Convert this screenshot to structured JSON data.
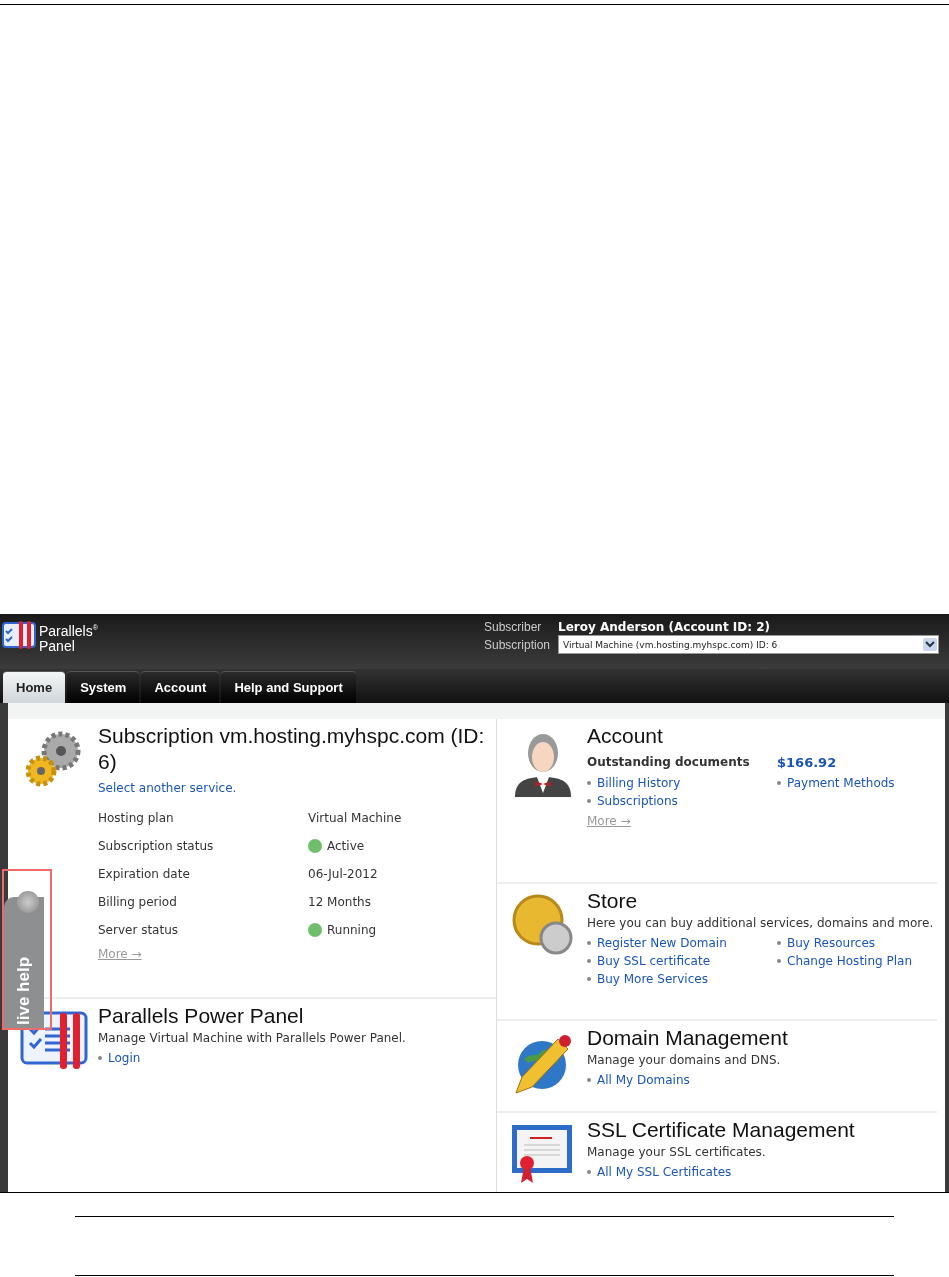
{
  "header": {
    "logo_lines": [
      "Parallels$^{®}$",
      "Panel"
    ],
    "subscriber": {
      "label": "Subscriber",
      "value": "Leroy Anderson (Account ID: 2)"
    },
    "subscription": {
      "label": "Subscription",
      "value": "Virtual Machine (vm.hosting.myhspc.com) ID: 6"
    }
  },
  "tabs": [
    {
      "label": "Home",
      "selected": true
    },
    {
      "label": "System",
      "selected": false
    },
    {
      "label": "Account",
      "selected": false
    },
    {
      "label": "Help and Support",
      "selected": false
    }
  ],
  "live_help": {
    "label": "live help"
  },
  "subscription_section": {
    "title": "Subscription vm.hosting.myhspc.com (ID: 6)",
    "link": "Select another service.",
    "details": [
      {
        "label": "Hosting plan",
        "value": "Virtual Machine"
      },
      {
        "label": "Subscription status",
        "value": "Active",
        "color": "#6fbf6a"
      },
      {
        "label": "Expiration date",
        "value": "06-Jul-2012"
      },
      {
        "label": "Billing period",
        "value": "12 Months"
      },
      {
        "label": "Server status",
        "value": "Running",
        "color": "#6fbf6a"
      }
    ],
    "more": "More →"
  },
  "power_panel": {
    "title": "Parallels Power Panel",
    "description": "Manage Virtual Machine with Parallels Power Panel.",
    "links": [
      "Login"
    ]
  },
  "right_sections": [
    {
      "kind": "account",
      "title": "Account",
      "summary": {
        "label": "Outstanding documents",
        "value": "$166.92"
      },
      "links": [
        "Billing History",
        "Payment Methods",
        "Subscriptions"
      ],
      "more": "More →"
    },
    {
      "kind": "store",
      "title": "Store",
      "description": "Here you can buy additional services, domains and more.",
      "links": [
        "Register New Domain",
        "Buy Resources",
        "Buy SSL certificate",
        "Change Hosting Plan",
        "Buy More Services"
      ]
    },
    {
      "kind": "domains",
      "title": "Domain Management",
      "description": "Manage your domains and DNS.",
      "links": [
        "All My Domains"
      ]
    },
    {
      "kind": "ssl",
      "title": "SSL Certificate Management",
      "description": "Manage your SSL certificates.",
      "links": [
        "All My SSL Certificates"
      ]
    }
  ]
}
